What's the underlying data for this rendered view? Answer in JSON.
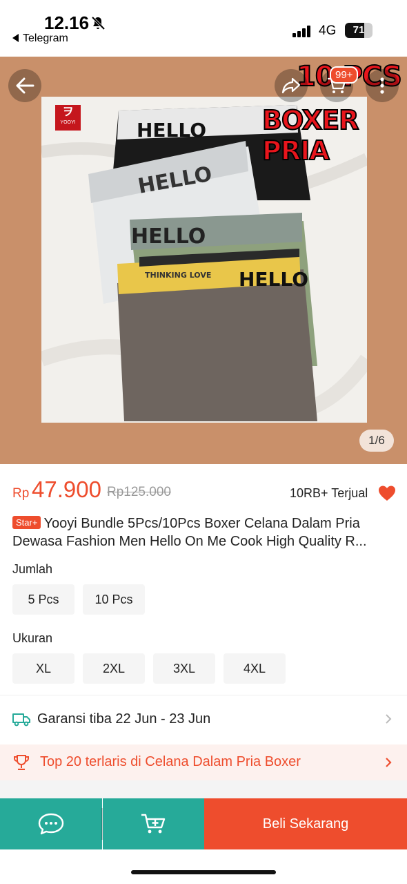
{
  "status_bar": {
    "time": "12.16",
    "back_app": "Telegram",
    "network": "4G",
    "battery_level": "71",
    "battery_fraction": 0.71
  },
  "gallery": {
    "cart_badge": "99+",
    "promo_line1": "10 PCS",
    "promo_line2": "BOXER PRIA",
    "brand_logo_text": "YOOYI",
    "page_counter": "1/6",
    "waistband_text": "HELLO",
    "waistband_tagline": "THINKING LOVE",
    "icons": [
      "back-arrow-icon",
      "share-icon",
      "cart-icon",
      "more-vertical-icon"
    ]
  },
  "product": {
    "currency": "Rp",
    "price": "47.900",
    "original_price": "Rp125.000",
    "sold": "10RB+ Terjual",
    "badge": "Star+",
    "title_line1": "Yooyi Bundle 5Pcs/10Pcs Boxer Celana Dalam Pria",
    "title_line2": "Dewasa Fashion Men Hello On Me Cook High Quality R..."
  },
  "variants": {
    "quantity_label": "Jumlah",
    "quantity_options": [
      "5 Pcs",
      "10 Pcs"
    ],
    "size_label": "Ukuran",
    "size_options": [
      "XL",
      "2XL",
      "3XL",
      "4XL"
    ]
  },
  "shipping": {
    "text": "Garansi tiba 22 Jun - 23 Jun"
  },
  "ranking": {
    "text": "Top 20 terlaris di Celana Dalam Pria Boxer"
  },
  "bottom_bar": {
    "buy_label": "Beli Sekarang"
  },
  "colors": {
    "accent": "#ee4d2d",
    "teal": "#26aa99",
    "hero_bg": "#c9906a"
  }
}
